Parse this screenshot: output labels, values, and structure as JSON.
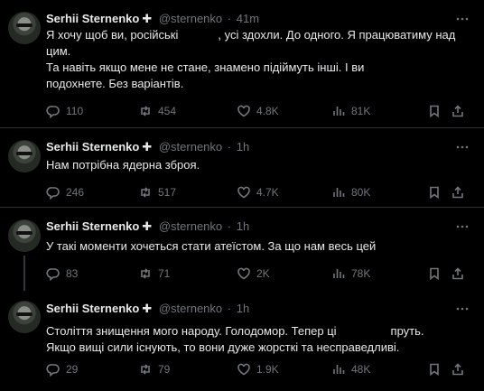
{
  "tweets": [
    {
      "name": "Serhii Sternenko",
      "plus": "✚",
      "handle": "@sternenko",
      "dot": "·",
      "time": "41m",
      "lines": [
        "Я хочу щоб ви, російські",
        ", усі здохли. До одного. Я працюватиму над",
        "цим.",
        "Та навіть якщо мене не стане, знамено підіймуть інші. І ви",
        "подохнете. Без варіантів."
      ],
      "replies": "110",
      "reposts": "454",
      "likes": "4.8K",
      "views": "81K"
    },
    {
      "name": "Serhii Sternenko",
      "plus": "✚",
      "handle": "@sternenko",
      "dot": "·",
      "time": "1h",
      "lines": [
        "Нам потрібна ядерна зброя."
      ],
      "replies": "246",
      "reposts": "517",
      "likes": "4.7K",
      "views": "80K"
    },
    {
      "name": "Serhii Sternenko",
      "plus": "✚",
      "handle": "@sternenko",
      "dot": "·",
      "time": "1h",
      "lines": [
        "У такі моменти хочеться стати атеїстом. За що нам весь цей"
      ],
      "replies": "83",
      "reposts": "71",
      "likes": "2K",
      "views": "78K"
    },
    {
      "name": "Serhii Sternenko",
      "plus": "✚",
      "handle": "@sternenko",
      "dot": "·",
      "time": "1h",
      "lines": [
        "Століття знищення мого народу. Голодомор. Тепер ці",
        "пруть.",
        "Якщо вищі сили існують, то вони дуже жорсткі та несправедливі."
      ],
      "replies": "29",
      "reposts": "79",
      "likes": "1.9K",
      "views": "48K"
    }
  ],
  "icons": {
    "reply": "reply-icon",
    "repost": "repost-icon",
    "like": "like-icon",
    "views": "views-icon",
    "bookmark": "bookmark-icon",
    "share": "share-icon",
    "more": "more-icon"
  },
  "colors": {
    "background": "#000000",
    "text": "#e7e9ea",
    "muted": "#71767b",
    "divider": "#2f3336"
  }
}
